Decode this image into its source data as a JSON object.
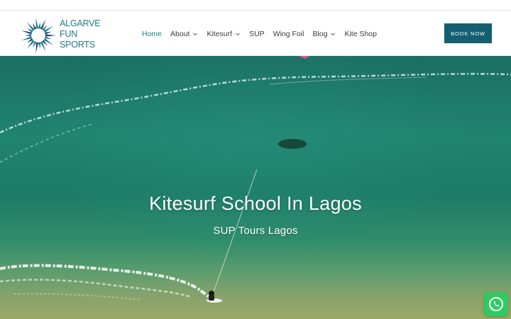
{
  "brand": {
    "logo_lines": [
      "ALGARVE",
      "FUN",
      "SPORTS"
    ],
    "logo_color": "#1e7a8c"
  },
  "nav": {
    "items": [
      {
        "label": "Home",
        "active": true,
        "has_dropdown": false
      },
      {
        "label": "About",
        "active": false,
        "has_dropdown": true
      },
      {
        "label": "Kitesurf",
        "active": false,
        "has_dropdown": true
      },
      {
        "label": "SUP",
        "active": false,
        "has_dropdown": false
      },
      {
        "label": "Wing Foil",
        "active": false,
        "has_dropdown": false
      },
      {
        "label": "Blog",
        "active": false,
        "has_dropdown": true
      },
      {
        "label": "Kite Shop",
        "active": false,
        "has_dropdown": false
      }
    ],
    "active_color": "#1e7a8c"
  },
  "cta": {
    "label": "BOOK NOW",
    "color": "#135e73"
  },
  "hero": {
    "title": "Kitesurf School In Lagos",
    "subtitle": "SUP Tours Lagos"
  },
  "floating": {
    "whatsapp_icon": "whatsapp-icon",
    "color": "#2ecc5f"
  }
}
